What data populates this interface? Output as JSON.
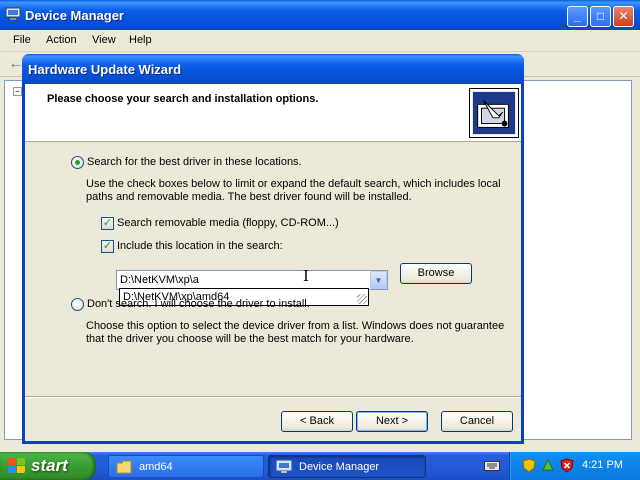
{
  "device_manager": {
    "title": "Device Manager",
    "menu": [
      "File",
      "Action",
      "View",
      "Help"
    ],
    "tree_expander": "−"
  },
  "wizard": {
    "title": "Hardware Update Wizard",
    "heading": "Please choose your search and installation options.",
    "option_search": {
      "label": "Search for the best driver in these locations.",
      "selected": true,
      "description": "Use the check boxes below to limit or expand the default search, which includes local paths and removable media. The best driver found will be installed."
    },
    "check_removable": {
      "label": "Search removable media (floppy, CD-ROM...)",
      "checked": true
    },
    "check_location": {
      "label": "Include this location in the search:",
      "checked": true
    },
    "location_value": "D:\\NetKVM\\xp\\a",
    "autocomplete_suggestion": "D:\\NetKVM\\xp\\amd64",
    "browse_label": "Browse",
    "option_dont_search": {
      "label": "Don't search. I will choose the driver to install.",
      "selected": false,
      "description": "Choose this option to select the device driver from a list.  Windows does not guarantee that the driver you choose will be the best match for your hardware."
    },
    "back_label": "< Back",
    "next_label": "Next >",
    "cancel_label": "Cancel"
  },
  "taskbar": {
    "start_label": "start",
    "tasks": [
      {
        "label": "amd64",
        "active": false
      },
      {
        "label": "Device Manager",
        "active": true
      }
    ],
    "clock": "4:21 PM"
  },
  "colors": {
    "title_blue": "#0552d8",
    "start_green": "#3a9c33",
    "tray_blue": "#0b77e0",
    "check_green": "#21a121"
  }
}
